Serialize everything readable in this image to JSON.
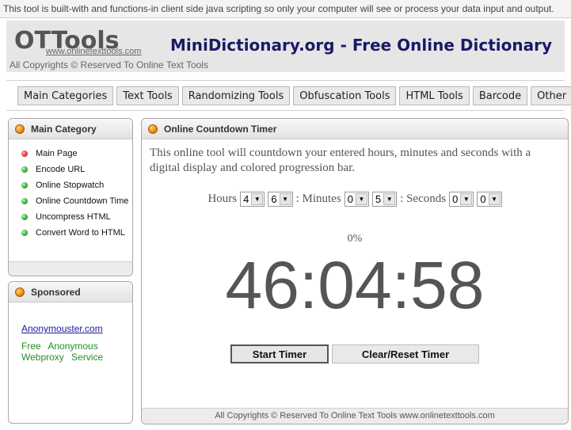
{
  "notice": "This tool is built-with and functions-in client side java scripting so only your computer will see or process your data input and output.",
  "header": {
    "logo": "OTTools",
    "logo_url": "www.onlinetexttools.com",
    "copyright": "All Copyrights © Reserved To Online Text Tools",
    "site_title": "MiniDictionary.org - Free Online Dictionary"
  },
  "nav": {
    "items": [
      {
        "label": "Main Categories"
      },
      {
        "label": "Text Tools"
      },
      {
        "label": "Randomizing Tools"
      },
      {
        "label": "Obfuscation Tools"
      },
      {
        "label": "HTML Tools"
      },
      {
        "label": "Barcode"
      },
      {
        "label": "Other"
      }
    ]
  },
  "sidebar": {
    "title": "Main Category",
    "items": [
      {
        "label": "Main Page",
        "dot": "red"
      },
      {
        "label": "Encode URL",
        "dot": "green"
      },
      {
        "label": "Online Stopwatch",
        "dot": "green"
      },
      {
        "label": "Online Countdown Time",
        "dot": "green"
      },
      {
        "label": "Uncompress HTML",
        "dot": "green"
      },
      {
        "label": "Convert Word to HTML",
        "dot": "green"
      }
    ]
  },
  "sponsored": {
    "title": "Sponsored",
    "link": "Anonymouster.com",
    "text": "Free Anonymous Webproxy Service"
  },
  "main": {
    "title": "Online Countdown Timer",
    "description": "This online tool will countdown your entered hours, minutes and seconds with a digital display and colored progression bar.",
    "hours_label": "Hours",
    "minutes_label": ": Minutes",
    "seconds_label": ": Seconds",
    "hours_tens": "4",
    "hours_ones": "6",
    "minutes_tens": "0",
    "minutes_ones": "5",
    "seconds_tens": "0",
    "seconds_ones": "0",
    "percent": "0%",
    "clock": "46:04:58",
    "start_label": "Start Timer",
    "reset_label": "Clear/Reset Timer",
    "footer": "All Copyrights © Reserved To Online Text Tools   www.onlinetexttools.com"
  }
}
